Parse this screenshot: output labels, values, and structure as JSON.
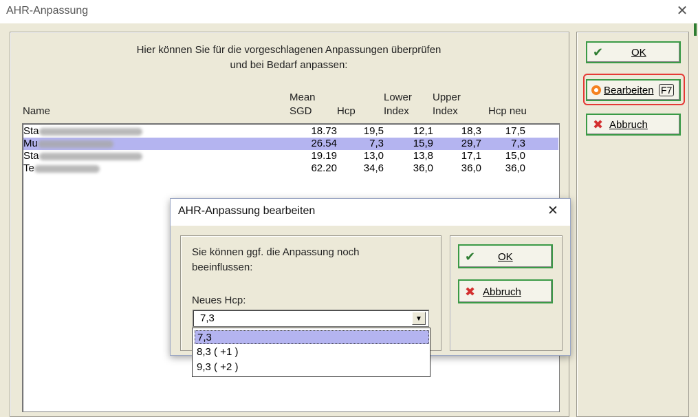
{
  "window": {
    "title": "AHR-Anpassung",
    "close_glyph": "✕"
  },
  "main": {
    "instructions_line1": "Hier können Sie für die vorgeschlagenen Anpassungen überprüfen",
    "instructions_line2": "und bei Bedarf anpassen:",
    "columns": {
      "name": "Name",
      "mean_1": "Mean",
      "mean_2": "SGD",
      "hcp": "Hcp",
      "lower_1": "Lower",
      "lower_2": "Index",
      "upper_1": "Upper",
      "upper_2": "Index",
      "hcp_new": "Hcp neu"
    },
    "rows": [
      {
        "name_prefix": "Sta",
        "mean_sgd": "18.73",
        "hcp": "19,5",
        "lower_index": "12,1",
        "upper_index": "18,3",
        "hcp_neu": "17,5",
        "selected": false
      },
      {
        "name_prefix": "Mu",
        "mean_sgd": "26.54",
        "hcp": "7,3",
        "lower_index": "15,9",
        "upper_index": "29,7",
        "hcp_neu": "7,3",
        "selected": true
      },
      {
        "name_prefix": "Sta",
        "mean_sgd": "19.19",
        "hcp": "13,0",
        "lower_index": "13,8",
        "upper_index": "17,1",
        "hcp_neu": "15,0",
        "selected": false
      },
      {
        "name_prefix": "Te",
        "mean_sgd": "62.20",
        "hcp": "34,6",
        "lower_index": "36,0",
        "upper_index": "36,0",
        "hcp_neu": "36,0",
        "selected": false
      }
    ]
  },
  "sidebar": {
    "ok_label": "OK",
    "edit_label": "Bearbeiten",
    "edit_shortcut": "F7",
    "cancel_label": "Abbruch"
  },
  "dialog": {
    "title": "AHR-Anpassung bearbeiten",
    "close_glyph": "✕",
    "message_line1": "Sie können ggf. die Anpassung noch",
    "message_line2": "beeinflussen:",
    "field_label": "Neues Hcp:",
    "combo_value": "7,3",
    "options": [
      "7,3",
      "8,3 ( +1 )",
      "9,3 ( +2 )"
    ],
    "ok_label": "OK",
    "cancel_label": "Abbruch"
  },
  "icons": {
    "check": "check-icon",
    "cancel": "cancel-x-icon",
    "edit": "edit-circle-icon",
    "dropdown": "chevron-down-icon"
  },
  "colors": {
    "selection": "#b4b4f0",
    "button_border": "#3a9a46",
    "highlight_outline": "#e53935",
    "panel_bg": "#ece9d8"
  }
}
